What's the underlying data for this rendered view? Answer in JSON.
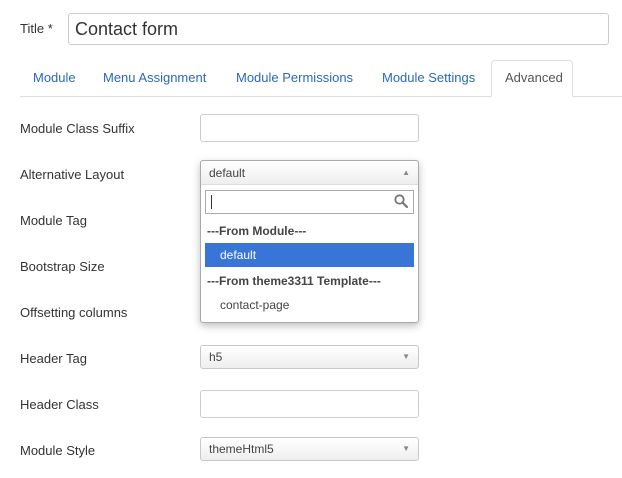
{
  "title_field": {
    "label": "Title *",
    "value": "Contact form"
  },
  "tabs": [
    {
      "label": "Module",
      "active": false
    },
    {
      "label": "Menu Assignment",
      "active": false
    },
    {
      "label": "Module Permissions",
      "active": false
    },
    {
      "label": "Module Settings",
      "active": false
    },
    {
      "label": "Advanced",
      "active": true
    }
  ],
  "fields": {
    "module_class_suffix": {
      "label": "Module Class Suffix",
      "value": ""
    },
    "alternative_layout": {
      "label": "Alternative Layout",
      "value": "default"
    },
    "module_tag": {
      "label": "Module Tag"
    },
    "bootstrap_size": {
      "label": "Bootstrap Size"
    },
    "offsetting_columns": {
      "label": "Offsetting columns"
    },
    "header_tag": {
      "label": "Header Tag",
      "value": "h5"
    },
    "header_class": {
      "label": "Header Class",
      "value": ""
    },
    "module_style": {
      "label": "Module Style",
      "value": "themeHtml5"
    }
  },
  "layout_dropdown": {
    "search_value": "",
    "groups": [
      {
        "label": "---From Module---",
        "options": [
          "default"
        ]
      },
      {
        "label": "---From theme3311 Template---",
        "options": [
          "contact-page"
        ]
      }
    ],
    "highlighted": "default"
  },
  "icons": {
    "dropdown_arrow": "triangle-icon",
    "search": "magnifier-icon"
  },
  "colors": {
    "tab_link": "#2a69b8",
    "highlight": "#3875d7"
  }
}
